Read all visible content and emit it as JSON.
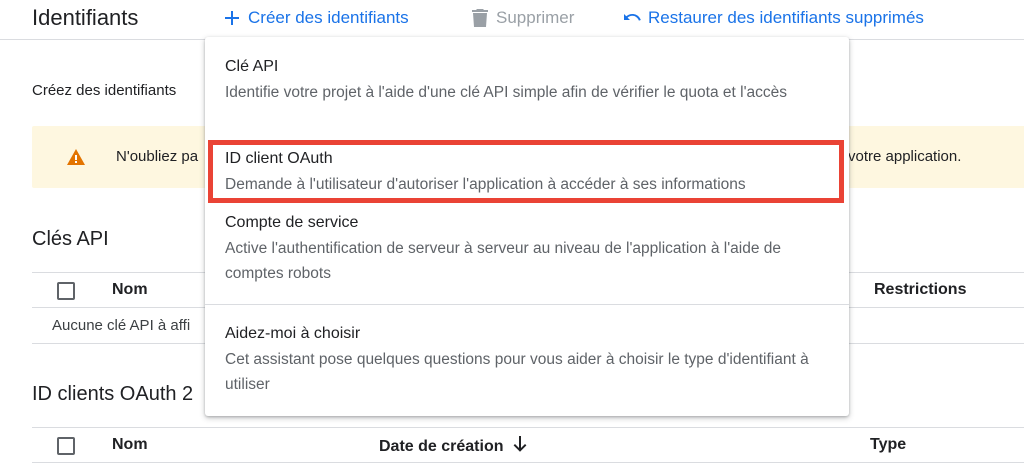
{
  "header": {
    "title": "Identifiants",
    "create_label": "Créer des identifiants",
    "delete_label": "Supprimer",
    "restore_label": "Restaurer des identifiants supprimés"
  },
  "intro_text": "Créez des identifiants",
  "warning": {
    "text_left": "N'oubliez pa",
    "text_right": "votre application."
  },
  "api_keys": {
    "title": "Clés API",
    "col_name": "Nom",
    "col_restrictions": "Restrictions",
    "empty_text": "Aucune clé API à affi"
  },
  "oauth_clients": {
    "title": "ID clients OAuth 2",
    "col_name": "Nom",
    "col_created": "Date de création",
    "col_type": "Type"
  },
  "menu": {
    "items": [
      {
        "title": "Clé API",
        "description": "Identifie votre projet à l'aide d'une clé API simple afin de vérifier le quota et l'accès"
      },
      {
        "title": "ID client OAuth",
        "description": "Demande à l'utilisateur d'autoriser l'application à accéder à ses informations"
      },
      {
        "title": "Compte de service",
        "description": "Active l'authentification de serveur à serveur au niveau de l'application à l'aide de comptes robots"
      },
      {
        "title": "Aidez-moi à choisir",
        "description": "Cet assistant pose quelques questions pour vous aider à choisir le type d'identifiant à utiliser"
      }
    ]
  },
  "colors": {
    "accent": "#1a73e8",
    "highlight": "#ea4335",
    "warning_bg": "#fef7e0",
    "warning_icon": "#e37400"
  },
  "icons": {
    "create": "plus-icon",
    "delete": "trash-icon",
    "restore": "undo-icon",
    "warning": "warning-icon",
    "sort": "arrow-down-icon"
  }
}
